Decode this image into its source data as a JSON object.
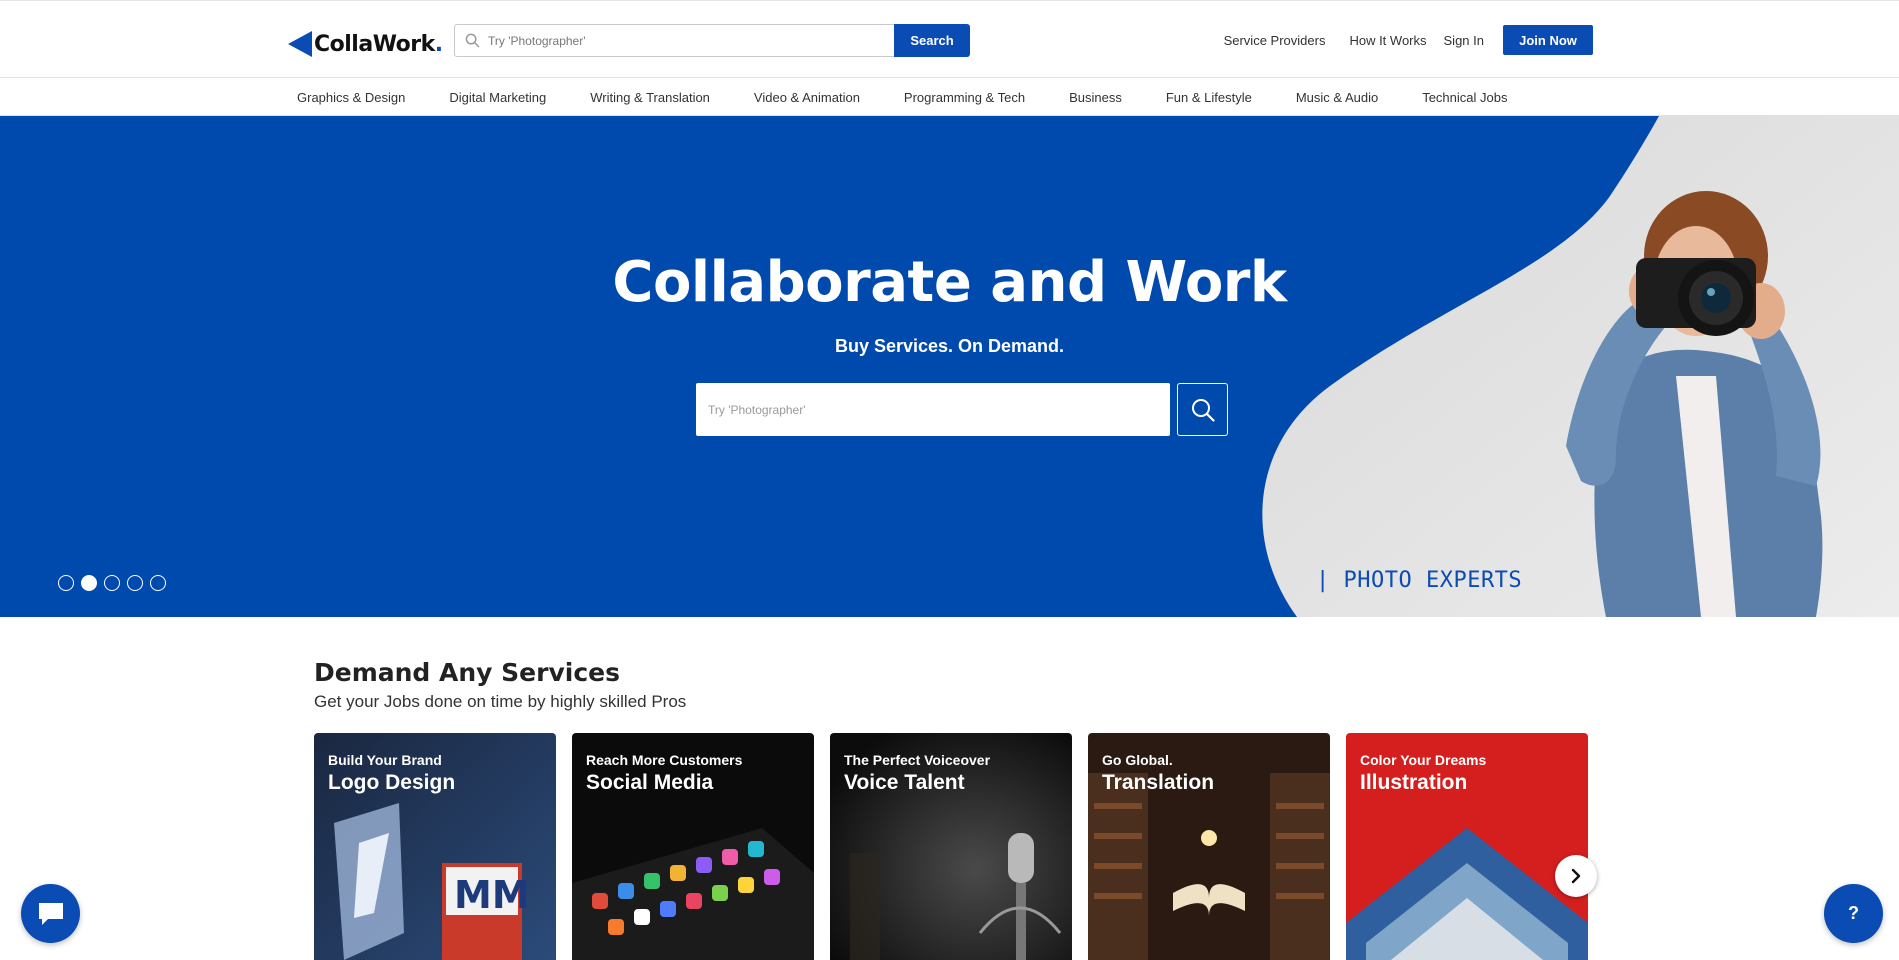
{
  "header": {
    "logo_text": "CollaWork",
    "logo_dot": ".",
    "search": {
      "placeholder": "Try 'Photographer'",
      "button_label": "Search"
    },
    "links": {
      "service_providers": "Service Providers",
      "how_it_works": "How It Works",
      "sign_in": "Sign In",
      "join_now": "Join Now"
    }
  },
  "categories": [
    "Graphics & Design",
    "Digital Marketing",
    "Writing & Translation",
    "Video & Animation",
    "Programming & Tech",
    "Business",
    "Fun & Lifestyle",
    "Music & Audio",
    "Technical Jobs"
  ],
  "hero": {
    "title": "Collaborate and Work",
    "subtitle": "Buy Services. On Demand.",
    "search_placeholder": "Try 'Photographer'",
    "slide_label": "| PHOTO EXPERTS",
    "slides_total": 5,
    "active_slide": 2
  },
  "services": {
    "title": "Demand Any Services",
    "subtitle": "Get your Jobs done on time by highly skilled Pros",
    "cards": [
      {
        "kicker": "Build Your Brand",
        "title": "Logo Design"
      },
      {
        "kicker": "Reach More Customers",
        "title": "Social Media"
      },
      {
        "kicker": "The Perfect Voiceover",
        "title": "Voice Talent"
      },
      {
        "kicker": "Go Global.",
        "title": "Translation"
      },
      {
        "kicker": "Color Your Dreams",
        "title": "Illustration"
      }
    ]
  },
  "widgets": {
    "help_label": "?"
  },
  "colors": {
    "brand_blue": "#0a4bb4",
    "hero_blue": "#004aad",
    "hero_light": "#e2e2e2"
  },
  "icons": {
    "search": "search-icon",
    "chat": "chat-icon",
    "next": "chevron-right-icon",
    "help": "help-icon"
  }
}
